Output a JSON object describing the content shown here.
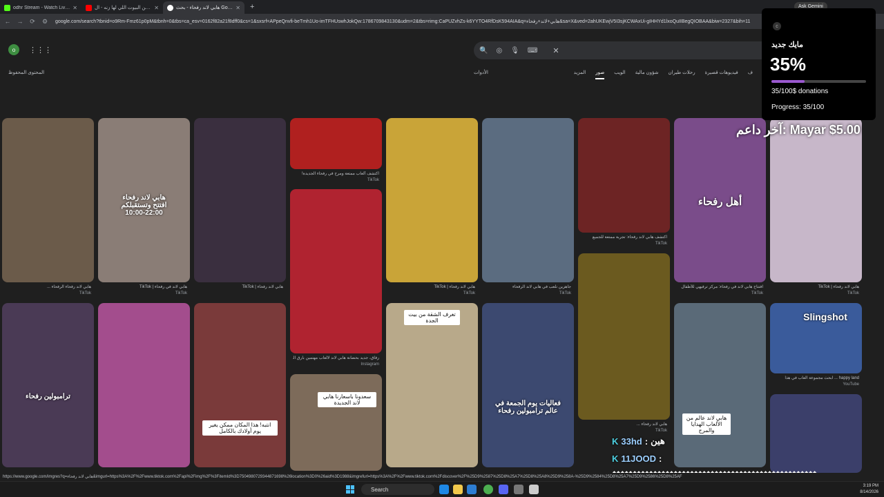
{
  "tabs": [
    {
      "title": "odhr Stream - Watch Live on Ki",
      "color": "#53fc18"
    },
    {
      "title": "يا دار وين البيوت اللي لها زنه - ال",
      "color": "#ff0000"
    },
    {
      "title": "هابي لاند رفحاء - بحث Google",
      "color": "#ffffff"
    }
  ],
  "ask_gemini": "Ask Gemini",
  "url": "google.com/search?tbnid=o9Rm-Fmz61p0pM&tbnh=0&tbs=ca_esv=0162f82a21f8dff0&cs=1&sxsrf=APpeQnvfi-beTmh1Uo-imTFHUswhJokQw:1786709843130&udm=2&tbs=rimg:CaPUZvhZs-k6YYTO4RfDsK594AIA&q=هابي+لاند+رفحاء&sa=X&ved=2ahUKEwjV5I3sjKCWAxUi-gIHHYd1lxoQuIIBegQIOBAA&biw=2327&bih=11",
  "avatar_letter": "o",
  "saved_content": "المحتوى المحفوظ",
  "tools": "الأدوات",
  "filters": [
    "المزيد",
    "صور",
    "الويب",
    "شؤون مالية",
    "رحلات طيران",
    "فيديوهات قصيرة",
    "ف"
  ],
  "selected_filter": "صور",
  "cards": [
    {
      "cap": "هابي لاند رفحاء الرفحاء ...",
      "src": "TikTok",
      "color": "#6b5b4a",
      "ov": ""
    },
    {
      "cap": "هابي لاند في رفحاء | TikTok",
      "src": "TikTok",
      "color": "#8a7d76",
      "ov": "هابي لاند رفحاء\nافتتح وتستقبلكم\n10:00-22:00"
    },
    {
      "cap": "هابي لاند رفحاء | TikTok",
      "src": "",
      "color": "#3a2f3f",
      "ov": ""
    },
    {
      "cap": "اكتشف ألعاب ممتعة ومرح في رفحاء الجديدة!",
      "src": "TikTok",
      "color": "#b0201f",
      "ov": ""
    },
    {
      "cap": "هابي لاند رفحاء | TikTok",
      "src": "TikTok",
      "color": "#c9a438",
      "ov": ""
    },
    {
      "cap": "جاهزين نلعب في هابي لاند الرفحاء",
      "src": "TikTok",
      "color": "#5b6c80",
      "ov": ""
    },
    {
      "cap": "اكتشف هابي لاند رفحاء: تجربة ممتعة للجميع",
      "src": "TikTok",
      "color": "#6d2424",
      "ov": ""
    },
    {
      "cap": "افتتاح هابي لاند في رفحاء: مركز ترفيهي للأطفال",
      "src": "TikTok",
      "color": "#7a4c8a",
      "ov": "أهل رفحاء"
    },
    {
      "cap": "هابي لاند رفحاء | TikTok",
      "src": "TikTok",
      "color": "#c7b7c9",
      "ov": ""
    },
    {
      "cap": "ترامبولين رفحاء",
      "src": "",
      "color": "#4a3a55",
      "ov": "ترامبولين رفحاء"
    },
    {
      "cap": "",
      "src": "",
      "color": "#a34d8d",
      "ov": ""
    },
    {
      "cap": "",
      "src": "",
      "color": "#7a3a3a",
      "ov": "انتبه! هذا المكان ممكن يغير يوم أولادك بالكامل"
    },
    {
      "cap": "رفاق، جديد بحضانة هابي لاند لالعاب مهتمين بأرق الق...",
      "src": "Instagram",
      "color": "#b02330",
      "ov": ""
    },
    {
      "cap": "",
      "src": "",
      "color": "#7d6b5a",
      "ov": "سعدونا باسعارنا هابي لاند الجديدة"
    },
    {
      "cap": "",
      "src": "",
      "color": "#b8a98a",
      "ov": "تغرف الشقة من بيت الجدة"
    },
    {
      "cap": "",
      "src": "",
      "color": "#3c4970",
      "ov": "فعاليات يوم الجمعة في عالم ترامبولين رفحاء"
    },
    {
      "cap": "هابي لاند رفحاء ...",
      "src": "TikTok",
      "color": "#6b5a1f",
      "ov": ""
    },
    {
      "cap": "",
      "src": "",
      "color": "#5a6a78",
      "ov": "هابي لاند عالم من الألعاب الهدايا والمرح"
    },
    {
      "cap": "happy land ... ابحث مجموعة العاب في هذا",
      "src": "YouTube",
      "color": "#3a5b9b",
      "ov": "Slingshot"
    },
    {
      "cap": "",
      "src": "",
      "color": "#3b3f6a",
      "ov": ""
    }
  ],
  "widget": {
    "title": "مايك جديد",
    "percent": "35%",
    "progress": 0.35,
    "donations": "35/100$ donations",
    "progress_text": "Progress: 35/100"
  },
  "last_donation": "آخر داعم: Mayar $5.00",
  "chat": [
    {
      "name": "33hd",
      "msg": ":"
    },
    {
      "name": "11JOOD",
      "msg": ":"
    }
  ],
  "chat_msg2": "هين",
  "status_url": "https://www.google.com/imgres?q=هابي لاند رفحاء&imgurl=https%3A%2F%2Fwww.tiktok.com%2Fapi%2Fimg%2F%3FitemId%3D7504980729344871698%26location%3D0%26aid%3D1988&imgrefurl=https%3A%2F%2Fwww.tiktok.com%2Fdiscover%2F%25D9%2587%25D8%25A7%25D8%25A8%25D9%258A-%25D9%2584%25D8%25A7%25D9%2586%25D8%25AF",
  "taskbar_search": "Search",
  "time": "3:19 PM",
  "date": "8/14/2026"
}
